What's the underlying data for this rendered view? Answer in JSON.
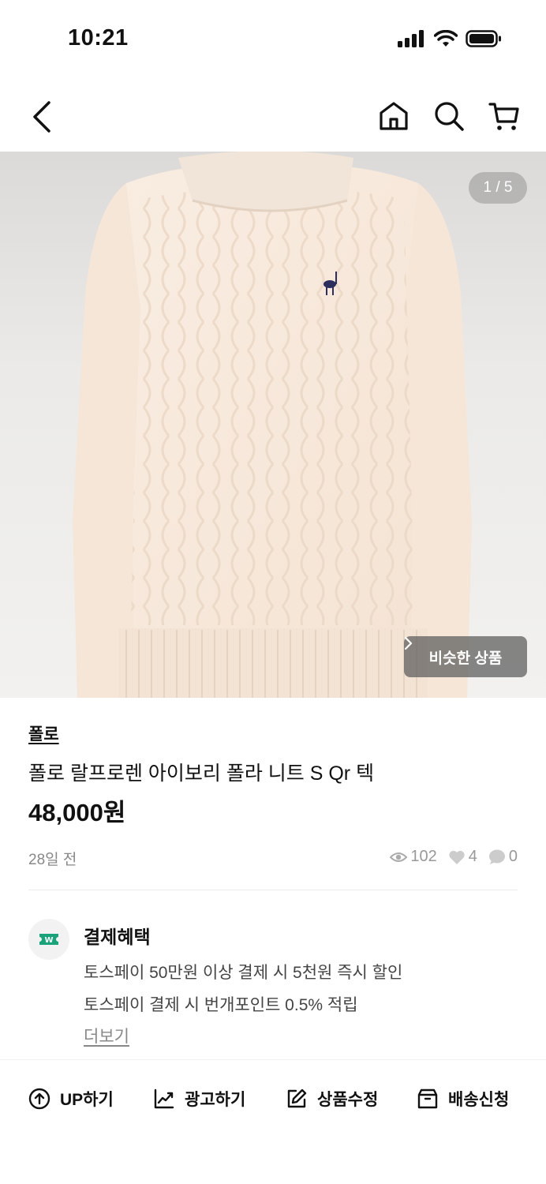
{
  "status_bar": {
    "time": "10:21"
  },
  "navbar": {
    "icons": [
      "back-icon",
      "home-icon",
      "search-icon",
      "cart-icon"
    ]
  },
  "gallery": {
    "counter": "1 / 5",
    "similar_label": "비슷한 상품"
  },
  "product": {
    "brand": "폴로",
    "title": "폴로 랄프로렌 아이보리 폴라 니트 S Qr 텍",
    "price": "48,000원",
    "posted": "28일 전",
    "views": "102",
    "likes": "4",
    "chats": "0"
  },
  "benefit": {
    "title": "결제혜택",
    "line1": "토스페이 50만원 이상 결제 시 5천원 즉시 할인",
    "line2": "토스페이 결제 시 번개포인트 0.5% 적립",
    "more": "더보기",
    "accent": "#1aa37a"
  },
  "actions": [
    {
      "label": "UP하기",
      "icon": "arrow-up-circle-icon"
    },
    {
      "label": "광고하기",
      "icon": "trend-chart-icon"
    },
    {
      "label": "상품수정",
      "icon": "edit-icon"
    },
    {
      "label": "배송신청",
      "icon": "box-icon"
    }
  ]
}
